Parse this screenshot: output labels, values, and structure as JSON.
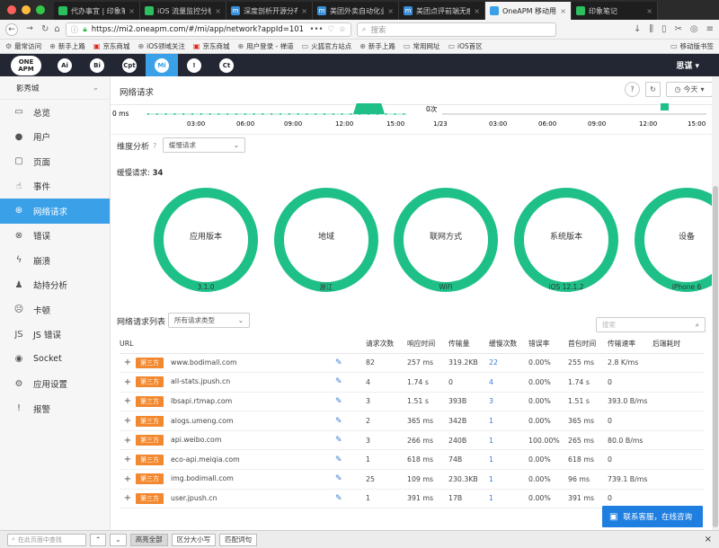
{
  "browser": {
    "tabs": [
      {
        "title": "代办事宜 | 印象笔记",
        "icon": "evernote-icon",
        "color": "#2dbe60"
      },
      {
        "title": "iOS 流量监控分析 | 周小",
        "icon": "evernote-icon",
        "color": "#2dbe60"
      },
      {
        "title": "深度剖析开源分布式",
        "icon": "m-icon",
        "color": "#3a8fd8"
      },
      {
        "title": "美团外卖自动化业务",
        "icon": "m-icon",
        "color": "#3a8fd8"
      },
      {
        "title": "美团点评前端无痕埋",
        "icon": "m-icon",
        "color": "#3a8fd8"
      },
      {
        "title": "OneAPM 移动用户体",
        "icon": "oneapm-icon",
        "color": "#3aa0e8"
      },
      {
        "title": "印象笔记",
        "icon": "evernote-icon",
        "color": "#2dbe60"
      }
    ],
    "url": "https://mi2.oneapm.com/#/mi/app/network?appId=101",
    "search_placeholder": "搜索",
    "bookmarks": [
      "最常访问",
      "新手上路",
      "京东商城",
      "iOS领域关注",
      "京东商城",
      "用户登录 - 禅道",
      "火狐官方站点",
      "新手上路",
      "常用网址",
      "iOS首区"
    ],
    "mobile_bookmarks": "移动版书签"
  },
  "header": {
    "logo": "ONE APM",
    "icons": [
      "Ai",
      "Bi",
      "Cpt",
      "Mi",
      "!",
      "Ct"
    ],
    "username": "思谋"
  },
  "sidebar": {
    "app": "影秀城",
    "items": [
      {
        "label": "总览",
        "icon": "overview-icon",
        "glyph": "▭"
      },
      {
        "label": "用户",
        "icon": "user-icon",
        "glyph": "●"
      },
      {
        "label": "页面",
        "icon": "page-icon",
        "glyph": "▢"
      },
      {
        "label": "事件",
        "icon": "hand-icon",
        "glyph": "☝"
      },
      {
        "label": "网络请求",
        "icon": "globe-icon",
        "glyph": "⊕"
      },
      {
        "label": "错误",
        "icon": "error-icon",
        "glyph": "⊗"
      },
      {
        "label": "崩溃",
        "icon": "bolt-icon",
        "glyph": "ϟ"
      },
      {
        "label": "劫持分析",
        "icon": "hijack-icon",
        "glyph": "♟"
      },
      {
        "label": "卡顿",
        "icon": "sad-icon",
        "glyph": "☹"
      },
      {
        "label": "JS 错误",
        "icon": "js-icon",
        "glyph": "JS"
      },
      {
        "label": "Socket",
        "icon": "socket-icon",
        "glyph": "◉"
      },
      {
        "label": "应用设置",
        "icon": "settings-icon",
        "glyph": "⚙"
      },
      {
        "label": "报警",
        "icon": "alert-icon",
        "glyph": "!"
      }
    ]
  },
  "page": {
    "title": "网络请求",
    "range": "今天",
    "dimension_label": "维度分析",
    "dimension_value": "缓慢请求",
    "slow_label": "缓慢请求:",
    "slow_count": "34",
    "list_title": "网络请求列表",
    "list_filter": "所有请求类型",
    "search_placeholder": "搜索"
  },
  "chart_data": [
    {
      "type": "area",
      "x": [
        "03:00",
        "06:00",
        "09:00",
        "12:00",
        "15:00"
      ],
      "ylabel_left": "0 ms",
      "series": [
        {
          "values_peak_at": "12:00"
        }
      ]
    },
    {
      "type": "bar",
      "x": [
        "1/23",
        "03:00",
        "06:00",
        "09:00",
        "12:00",
        "15:00"
      ],
      "ylabel_left": "0次"
    }
  ],
  "donuts": [
    {
      "name": "应用版本",
      "value": "3.1.0"
    },
    {
      "name": "地域",
      "value": "浙江"
    },
    {
      "name": "联网方式",
      "value": "WiFi"
    },
    {
      "name": "系统版本",
      "value": "iOS 12.1.2"
    },
    {
      "name": "设备",
      "value": "iPhone 6"
    }
  ],
  "table": {
    "headers": [
      "URL",
      "请求次数",
      "响应时间",
      "传输量",
      "缓慢次数",
      "错误率",
      "首包时间",
      "传输速率",
      "后端耗时"
    ],
    "tag": "第三方",
    "rows": [
      [
        "www.bodimall.com",
        "82",
        "257 ms",
        "319.2KB",
        "22",
        "0.00%",
        "255 ms",
        "2.8 K/ms",
        ""
      ],
      [
        "all-stats.jpush.cn",
        "4",
        "1.74 s",
        "0",
        "4",
        "0.00%",
        "1.74 s",
        "0",
        ""
      ],
      [
        "lbsapi.rtmap.com",
        "3",
        "1.51 s",
        "393B",
        "3",
        "0.00%",
        "1.51 s",
        "393.0 B/ms",
        ""
      ],
      [
        "alogs.umeng.com",
        "2",
        "365 ms",
        "342B",
        "1",
        "0.00%",
        "365 ms",
        "0",
        ""
      ],
      [
        "api.weibo.com",
        "3",
        "266 ms",
        "240B",
        "1",
        "100.00%",
        "265 ms",
        "80.0 B/ms",
        ""
      ],
      [
        "eco-api.meiqia.com",
        "1",
        "618 ms",
        "74B",
        "1",
        "0.00%",
        "618 ms",
        "0",
        ""
      ],
      [
        "img.bodimall.com",
        "25",
        "109 ms",
        "230.3KB",
        "1",
        "0.00%",
        "96 ms",
        "739.1 B/ms",
        ""
      ],
      [
        "user.jpush.cn",
        "1",
        "391 ms",
        "17B",
        "1",
        "0.00%",
        "391 ms",
        "0",
        ""
      ]
    ]
  },
  "findbar": {
    "placeholder": "在此页面中查找",
    "buttons": [
      "高亮全部",
      "区分大小写",
      "匹配词句"
    ]
  },
  "chat": "联系客服，在线咨询"
}
